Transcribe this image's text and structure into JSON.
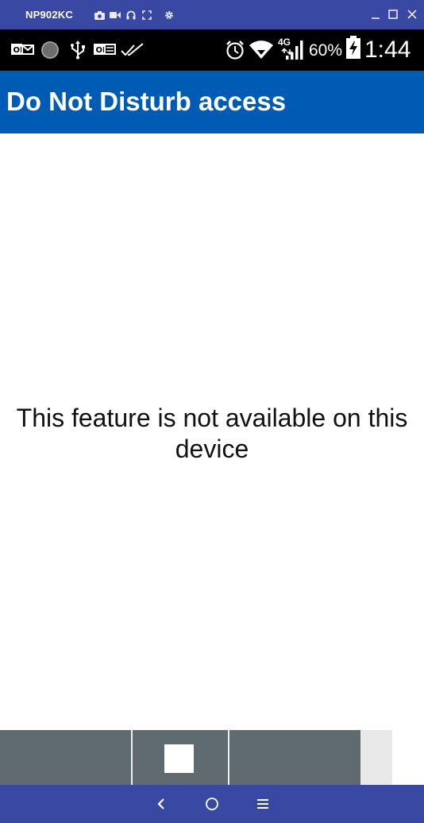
{
  "emulator": {
    "title": "NP902KC",
    "tools": [
      "camera-icon",
      "video-icon",
      "headset-icon",
      "fullscreen-icon",
      "settings-icon"
    ],
    "window_controls": [
      "minimize-icon",
      "maximize-icon",
      "close-icon"
    ]
  },
  "status_bar": {
    "left_icons": [
      "ok-message-icon",
      "circle-icon",
      "usb-icon",
      "ok-keyboard-icon",
      "double-check-icon"
    ],
    "network": "4G",
    "battery_percent": "60%",
    "time": "1:44"
  },
  "app_bar": {
    "title": "Do Not Disturb access"
  },
  "content": {
    "message": "This feature is not available on this device"
  },
  "nav_bar": {
    "buttons": [
      "back-icon",
      "home-icon",
      "menu-icon"
    ]
  },
  "colors": {
    "emulator_bar": "#3949a3",
    "app_bar": "#005bb5",
    "status_bar": "#000000",
    "overlay": "#5f6b70"
  }
}
